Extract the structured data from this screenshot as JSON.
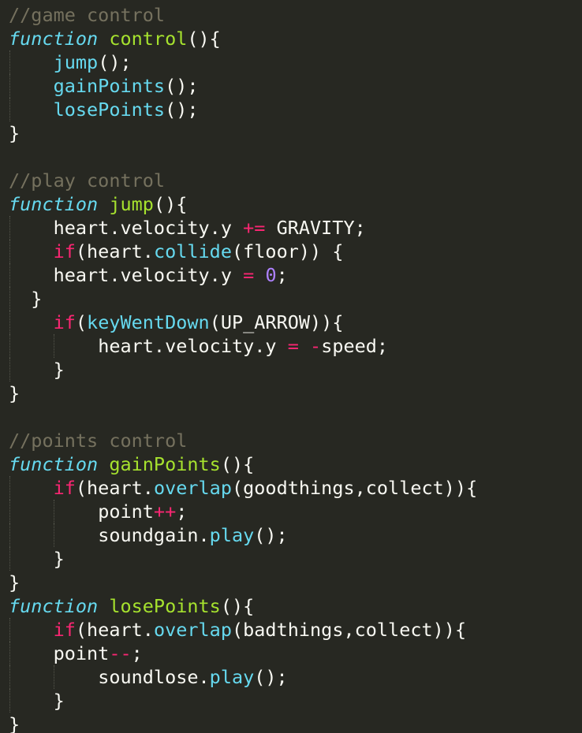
{
  "editor": {
    "lines": [
      {
        "indent": 0,
        "tokens": [
          {
            "t": "//game control",
            "c": "c"
          }
        ]
      },
      {
        "indent": 0,
        "tokens": [
          {
            "t": "function",
            "c": "k"
          },
          {
            "t": " ",
            "c": "p"
          },
          {
            "t": "control",
            "c": "fn"
          },
          {
            "t": "(){",
            "c": "p"
          }
        ]
      },
      {
        "indent": 4,
        "guides": [
          0
        ],
        "tokens": [
          {
            "t": "jump",
            "c": "b"
          },
          {
            "t": "();",
            "c": "p"
          }
        ]
      },
      {
        "indent": 4,
        "guides": [
          0
        ],
        "tokens": [
          {
            "t": "gainPoints",
            "c": "b"
          },
          {
            "t": "();",
            "c": "p"
          }
        ]
      },
      {
        "indent": 4,
        "guides": [
          0
        ],
        "tokens": [
          {
            "t": "losePoints",
            "c": "b"
          },
          {
            "t": "();",
            "c": "p"
          }
        ]
      },
      {
        "indent": 0,
        "tokens": [
          {
            "t": "}",
            "c": "p"
          }
        ]
      },
      {
        "indent": 0,
        "tokens": []
      },
      {
        "indent": 0,
        "tokens": [
          {
            "t": "//play control",
            "c": "c"
          }
        ]
      },
      {
        "indent": 0,
        "tokens": [
          {
            "t": "function",
            "c": "k"
          },
          {
            "t": " ",
            "c": "p"
          },
          {
            "t": "jump",
            "c": "fn"
          },
          {
            "t": "(){",
            "c": "p"
          }
        ]
      },
      {
        "indent": 4,
        "guides": [
          0
        ],
        "tokens": [
          {
            "t": "heart.velocity.y ",
            "c": "t"
          },
          {
            "t": "+=",
            "c": "op"
          },
          {
            "t": " GRAVITY;",
            "c": "t"
          }
        ]
      },
      {
        "indent": 4,
        "guides": [
          0
        ],
        "tokens": [
          {
            "t": "if",
            "c": "kw"
          },
          {
            "t": "(heart.",
            "c": "p"
          },
          {
            "t": "collide",
            "c": "b"
          },
          {
            "t": "(floor)) {",
            "c": "p"
          }
        ]
      },
      {
        "indent": 4,
        "guides": [
          0
        ],
        "tokens": [
          {
            "t": "heart.velocity.y ",
            "c": "t"
          },
          {
            "t": "=",
            "c": "op"
          },
          {
            "t": " ",
            "c": "p"
          },
          {
            "t": "0",
            "c": "n"
          },
          {
            "t": ";",
            "c": "p"
          }
        ]
      },
      {
        "indent": 2,
        "guides": [
          0
        ],
        "tokens": [
          {
            "t": "}",
            "c": "p"
          }
        ]
      },
      {
        "indent": 4,
        "guides": [
          0
        ],
        "tokens": [
          {
            "t": "if",
            "c": "kw"
          },
          {
            "t": "(",
            "c": "p"
          },
          {
            "t": "keyWentDown",
            "c": "b"
          },
          {
            "t": "(UP_ARROW)){",
            "c": "p"
          }
        ]
      },
      {
        "indent": 8,
        "guides": [
          0,
          4
        ],
        "tokens": [
          {
            "t": "heart.velocity.y ",
            "c": "t"
          },
          {
            "t": "=",
            "c": "op"
          },
          {
            "t": " ",
            "c": "p"
          },
          {
            "t": "-",
            "c": "op"
          },
          {
            "t": "speed;",
            "c": "t"
          }
        ]
      },
      {
        "indent": 4,
        "guides": [
          0
        ],
        "tokens": [
          {
            "t": "}",
            "c": "p"
          }
        ]
      },
      {
        "indent": 0,
        "tokens": [
          {
            "t": "}",
            "c": "p"
          }
        ]
      },
      {
        "indent": 0,
        "tokens": []
      },
      {
        "indent": 0,
        "tokens": [
          {
            "t": "//points control",
            "c": "c"
          }
        ]
      },
      {
        "indent": 0,
        "tokens": [
          {
            "t": "function",
            "c": "k"
          },
          {
            "t": " ",
            "c": "p"
          },
          {
            "t": "gainPoints",
            "c": "fn"
          },
          {
            "t": "(){",
            "c": "p"
          }
        ]
      },
      {
        "indent": 4,
        "guides": [
          0
        ],
        "tokens": [
          {
            "t": "if",
            "c": "kw"
          },
          {
            "t": "(heart.",
            "c": "p"
          },
          {
            "t": "overlap",
            "c": "b"
          },
          {
            "t": "(goodthings,collect)){",
            "c": "p"
          }
        ]
      },
      {
        "indent": 8,
        "guides": [
          0,
          4
        ],
        "tokens": [
          {
            "t": "point",
            "c": "t"
          },
          {
            "t": "++",
            "c": "op"
          },
          {
            "t": ";",
            "c": "p"
          }
        ]
      },
      {
        "indent": 8,
        "guides": [
          0,
          4
        ],
        "tokens": [
          {
            "t": "soundgain.",
            "c": "t"
          },
          {
            "t": "play",
            "c": "b"
          },
          {
            "t": "();",
            "c": "p"
          }
        ]
      },
      {
        "indent": 4,
        "guides": [
          0
        ],
        "tokens": [
          {
            "t": "}",
            "c": "p"
          }
        ]
      },
      {
        "indent": 0,
        "tokens": [
          {
            "t": "}",
            "c": "p"
          }
        ]
      },
      {
        "indent": 0,
        "tokens": [
          {
            "t": "function",
            "c": "k"
          },
          {
            "t": " ",
            "c": "p"
          },
          {
            "t": "losePoints",
            "c": "fn"
          },
          {
            "t": "(){",
            "c": "p"
          }
        ]
      },
      {
        "indent": 4,
        "guides": [
          0
        ],
        "tokens": [
          {
            "t": "if",
            "c": "kw"
          },
          {
            "t": "(heart.",
            "c": "p"
          },
          {
            "t": "overlap",
            "c": "b"
          },
          {
            "t": "(badthings,collect)){",
            "c": "p"
          }
        ]
      },
      {
        "indent": 4,
        "guides": [
          0
        ],
        "tokens": [
          {
            "t": "point",
            "c": "t"
          },
          {
            "t": "--",
            "c": "op"
          },
          {
            "t": ";",
            "c": "p"
          }
        ]
      },
      {
        "indent": 8,
        "guides": [
          0,
          4
        ],
        "tokens": [
          {
            "t": "soundlose.",
            "c": "t"
          },
          {
            "t": "play",
            "c": "b"
          },
          {
            "t": "();",
            "c": "p"
          }
        ]
      },
      {
        "indent": 4,
        "guides": [
          0
        ],
        "tokens": [
          {
            "t": "}",
            "c": "p"
          }
        ]
      },
      {
        "indent": 0,
        "tokens": [
          {
            "t": "}",
            "c": "p"
          }
        ]
      }
    ]
  },
  "theme": {
    "background": "#272822",
    "comment": "#75715e",
    "storage_keyword": "#66d9ef",
    "function_name": "#a6e22e",
    "builtin_call": "#66d9ef",
    "operator": "#f92672",
    "number": "#ae81ff",
    "plain": "#f8f8f2",
    "indent_guide": "#55564c"
  }
}
